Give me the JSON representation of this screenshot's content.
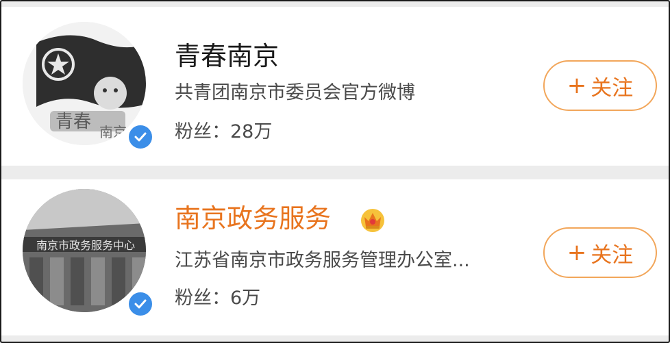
{
  "accounts": [
    {
      "name": "青春南京",
      "description": "共青团南京市委员会官方微博",
      "fans_label": "粉丝：",
      "fans_count": "28万",
      "follow_plus": "+",
      "follow_label": "关注",
      "verified": true,
      "vip_crown": false
    },
    {
      "name": "南京政务服务",
      "description": "江苏省南京市政务服务管理办公室...",
      "fans_label": "粉丝：",
      "fans_count": "6万",
      "follow_plus": "+",
      "follow_label": "关注",
      "verified": true,
      "vip_crown": true
    }
  ],
  "colors": {
    "accent": "#e8741e",
    "button_border": "#f2a65a",
    "verified_blue": "#3b8ee8"
  },
  "icons": [
    "verified-badge-icon",
    "crown-icon",
    "plus-icon"
  ]
}
